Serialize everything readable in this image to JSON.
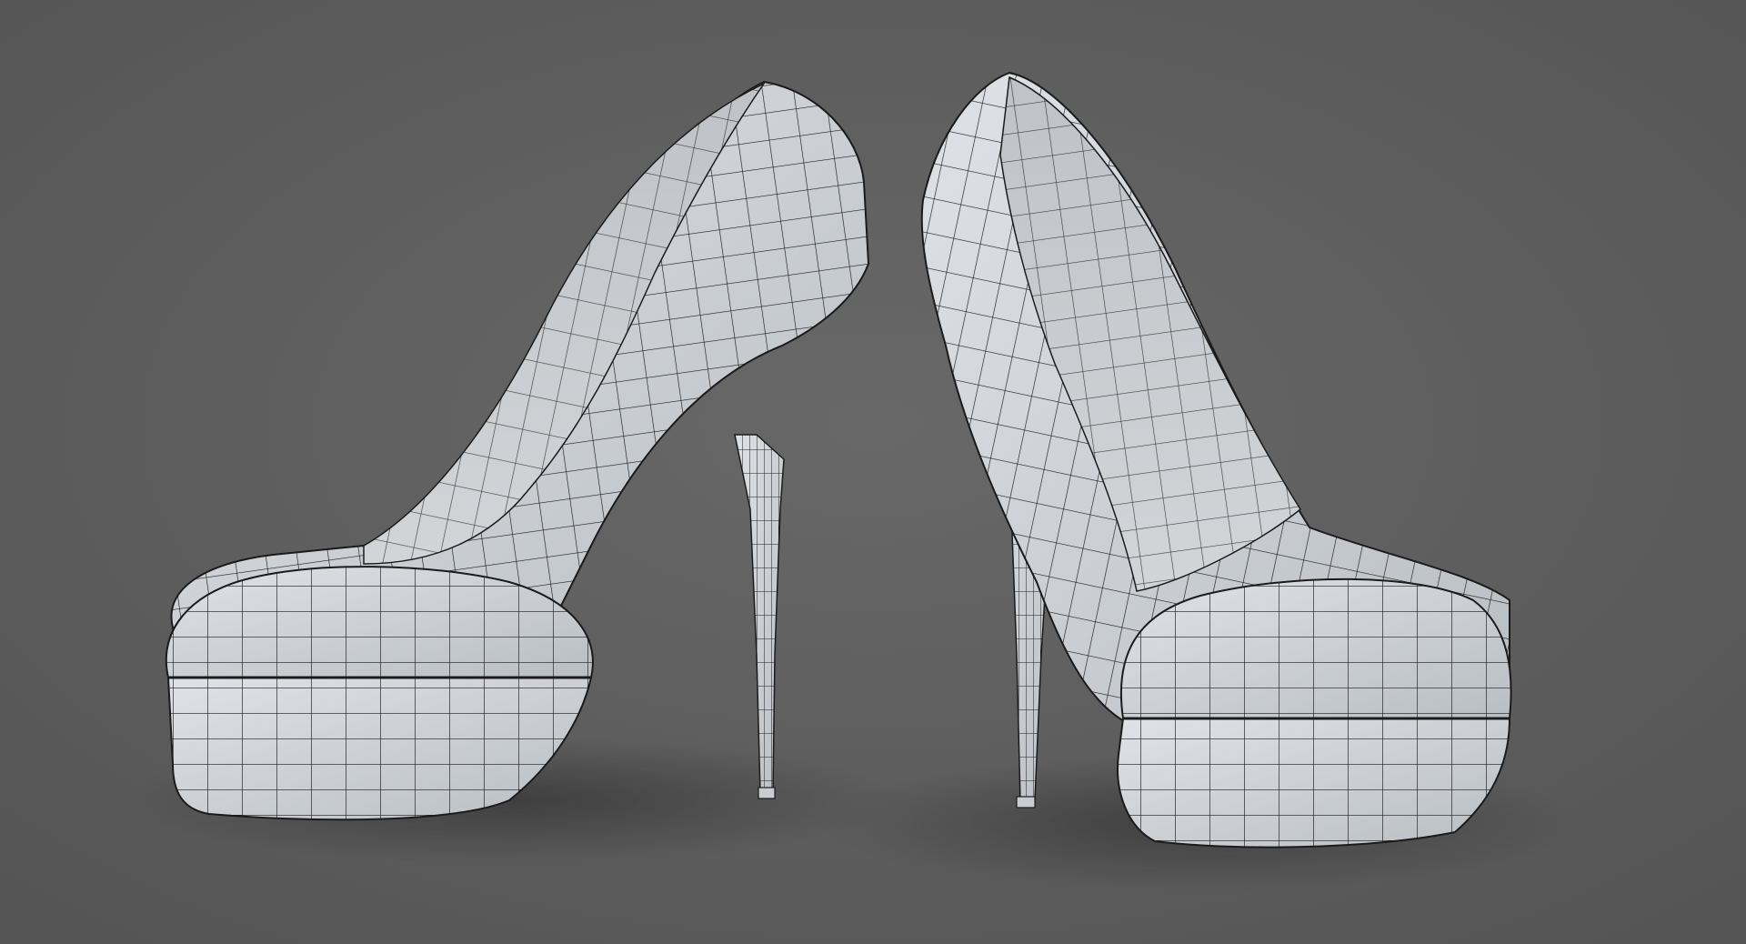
{
  "scene": {
    "subject": "wireframe-render-platform-high-heels",
    "shoe_count": 2,
    "colors": {
      "background": "#5d5d5d",
      "background_light": "#686868",
      "shoe_fill": "#d4d8dc",
      "shoe_shadow": "#b7bcc1",
      "inner_fill": "#c6cacd",
      "wire": "#1b1b1b",
      "floor_shadow": "#3e3e3e"
    }
  }
}
